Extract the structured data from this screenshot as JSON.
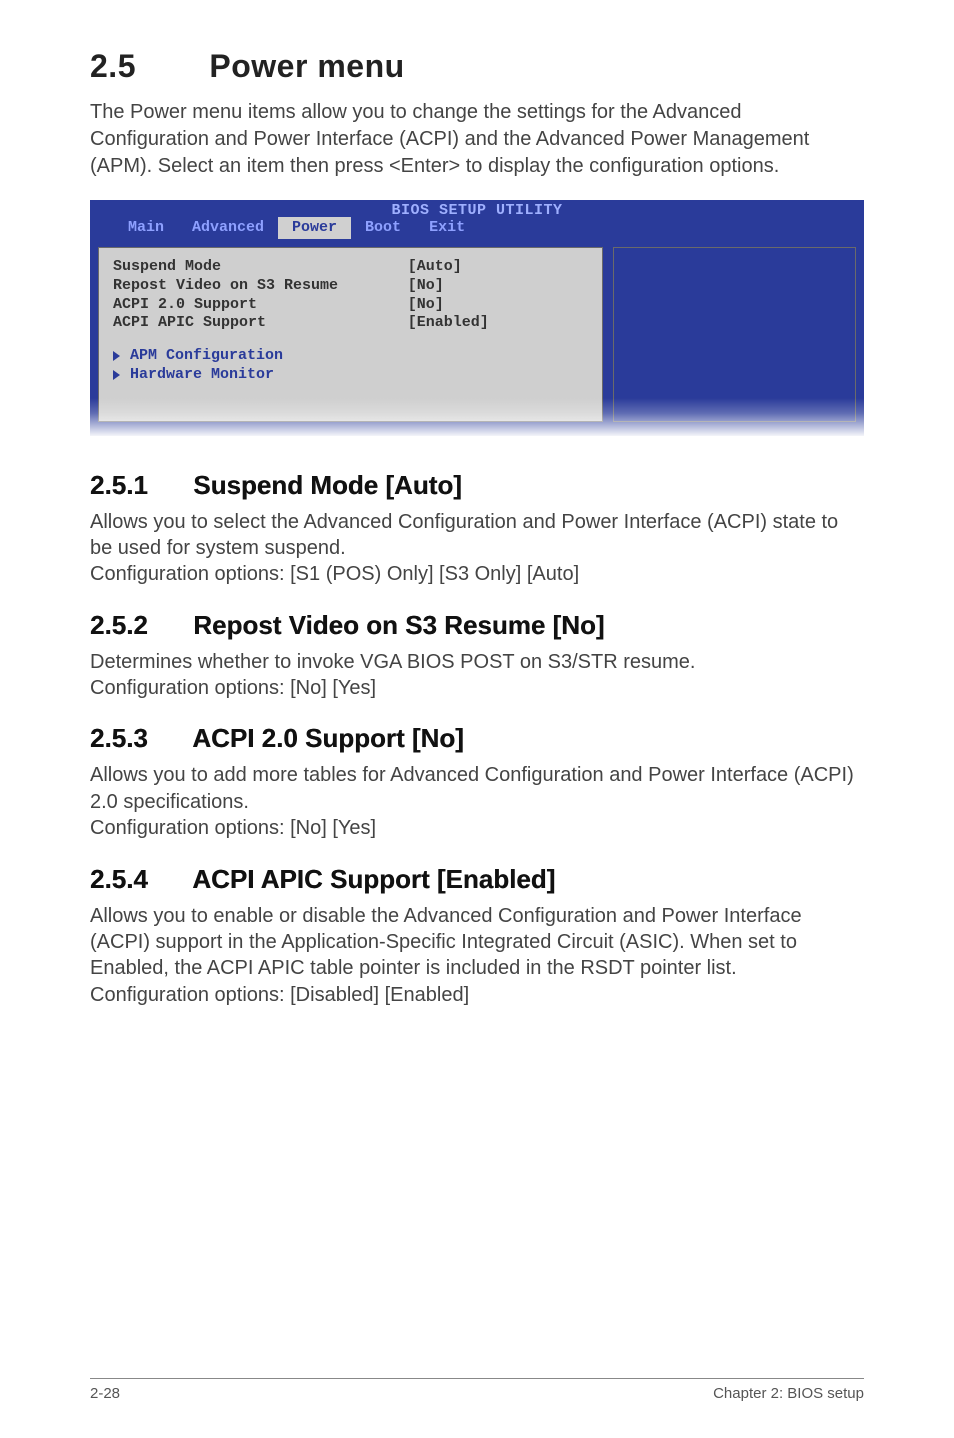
{
  "heading": {
    "number": "2.5",
    "title": "Power menu"
  },
  "intro": "The Power menu items allow you to change the settings for the Advanced Configuration and Power Interface (ACPI) and the Advanced Power Management (APM). Select an item then press <Enter> to display the configuration options.",
  "bios": {
    "title": "BIOS SETUP UTILITY",
    "tabs": [
      "Main",
      "Advanced",
      "Power",
      "Boot",
      "Exit"
    ],
    "selected_tab": "Power",
    "rows": [
      {
        "label": "Suspend Mode",
        "value": "[Auto]"
      },
      {
        "label": "Repost Video on S3 Resume",
        "value": "[No]"
      },
      {
        "label": "ACPI 2.0 Support",
        "value": "[No]"
      },
      {
        "label": "ACPI APIC Support",
        "value": "[Enabled]"
      }
    ],
    "submenus": [
      "APM Configuration",
      "Hardware Monitor"
    ]
  },
  "sections": [
    {
      "number": "2.5.1",
      "title": "Suspend Mode [Auto]",
      "body": "Allows you to select the Advanced Configuration and Power Interface (ACPI) state to be used for system suspend.\nConfiguration options: [S1 (POS) Only] [S3 Only] [Auto]"
    },
    {
      "number": "2.5.2",
      "title": "Repost Video on S3 Resume [No]",
      "body": "Determines whether to invoke VGA BIOS POST on S3/STR resume.\nConfiguration options: [No] [Yes]"
    },
    {
      "number": "2.5.3",
      "title": "ACPI 2.0 Support [No]",
      "body": "Allows you to add more tables for Advanced Configuration and Power Interface (ACPI) 2.0 specifications.\nConfiguration options: [No] [Yes]"
    },
    {
      "number": "2.5.4",
      "title": "ACPI APIC Support [Enabled]",
      "body": "Allows you to enable or disable the Advanced Configuration and Power Interface (ACPI) support in the Application-Specific Integrated Circuit (ASIC). When set to Enabled, the ACPI APIC table pointer is included in the RSDT pointer list.\nConfiguration options: [Disabled] [Enabled]"
    }
  ],
  "footer": {
    "left": "2-28",
    "right": "Chapter 2: BIOS setup"
  }
}
